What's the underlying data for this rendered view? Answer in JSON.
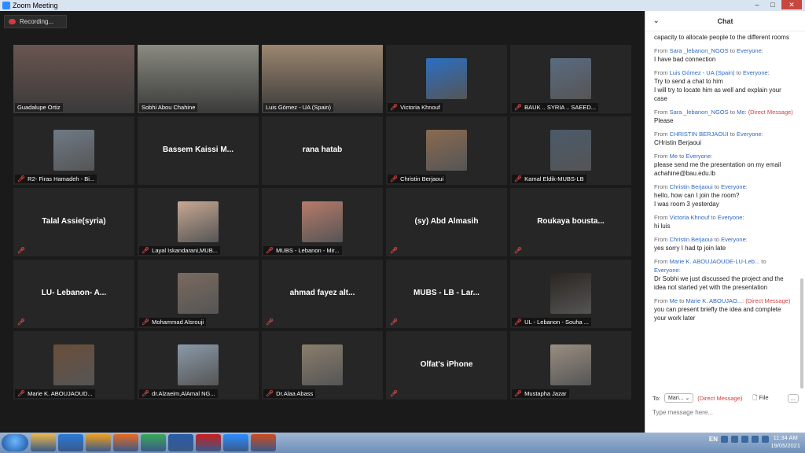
{
  "window": {
    "title": "Zoom Meeting"
  },
  "recording": {
    "label": "Recording..."
  },
  "tiles": [
    {
      "name": "Guadalupe Ortiz",
      "kind": "photo",
      "color": "#6a5550",
      "muted": false
    },
    {
      "name": "Sobhi Abou Chahine",
      "kind": "photo",
      "color": "#8a8a80",
      "muted": false
    },
    {
      "name": "Luis Gómez - UA (Spain)",
      "kind": "photo",
      "color": "#9c8670",
      "muted": false,
      "active": true
    },
    {
      "name": "Victoria Khnouf",
      "kind": "avatar",
      "color": "#2a6fc4",
      "muted": true
    },
    {
      "name": "BAUK .. SYRIA .. SAEED...",
      "kind": "avatar",
      "color": "#5a6b80",
      "muted": true
    },
    {
      "name": "R2- Firas Hamadeh - Bi...",
      "kind": "avatar",
      "color": "#6f7a86",
      "muted": true
    },
    {
      "name": "Bassem Kaissi M...",
      "kind": "text",
      "label": "",
      "muted": false
    },
    {
      "name": "rana hatab",
      "kind": "text",
      "label": "",
      "muted": false
    },
    {
      "name": "Christin Berjaoui",
      "kind": "avatar",
      "color": "#8a6a50",
      "muted": true
    },
    {
      "name": "Kamal Eldik-MUBS-LB",
      "kind": "avatar",
      "color": "#4a5a6a",
      "muted": true
    },
    {
      "name": "Talal Assie(syria)",
      "kind": "text",
      "label": "",
      "muted": true
    },
    {
      "name": "Layal Iskandarani,MUB...",
      "kind": "avatar",
      "color": "#c7a893",
      "muted": true
    },
    {
      "name": "MUBS - Lebanon - Mir...",
      "kind": "avatar",
      "color": "#b87a6a",
      "muted": true
    },
    {
      "name": "(sy) Abd Almasih",
      "kind": "text",
      "label": "",
      "muted": true
    },
    {
      "name": "Roukaya bousta...",
      "kind": "text",
      "label": "",
      "muted": true
    },
    {
      "name": "LU- Lebanon- A...",
      "kind": "text",
      "label": "",
      "muted": true
    },
    {
      "name": "Mohammad Alsrouji",
      "kind": "avatar",
      "color": "#7a6a5e",
      "muted": true
    },
    {
      "name": "ahmad fayez alt...",
      "kind": "text",
      "label": "",
      "muted": true
    },
    {
      "name": "MUBS - LB - Lar...",
      "kind": "text",
      "label": "",
      "muted": true
    },
    {
      "name": "UL - Lebanon - Souha ...",
      "kind": "avatar",
      "color": "#2a2520",
      "muted": true
    },
    {
      "name": "Marie K. ABOUJAOUD...",
      "kind": "avatar",
      "color": "#6a4e3a",
      "muted": true
    },
    {
      "name": "dr.Alzaeim,AlAmal NG...",
      "kind": "avatar",
      "color": "#8a9aa8",
      "muted": true
    },
    {
      "name": "Dr.Alaa Abass",
      "kind": "avatar",
      "color": "#8a7e6c",
      "muted": true
    },
    {
      "name": "Olfat's iPhone",
      "kind": "text",
      "label": "",
      "muted": true
    },
    {
      "name": "Mustapha Jazar",
      "kind": "avatar",
      "color": "#9a8e80",
      "muted": true
    }
  ],
  "chat": {
    "title": "Chat",
    "messages": [
      {
        "from": "",
        "to": "",
        "dm": "",
        "text": "capacity to allocate people to the different rooms"
      },
      {
        "from": "Sara _lebanon_NGOS",
        "to": "Everyone",
        "dm": "",
        "text": "I have bad connection"
      },
      {
        "from": "Luis Gómez - UA (Spain)",
        "to": "Everyone",
        "dm": "",
        "text": "Try to send a chat to him\nI will try to locate him as well and explain your case"
      },
      {
        "from": "Sara _lebanon_NGOS",
        "to": "Me",
        "dm": "(Direct Message)",
        "text": "Please"
      },
      {
        "from": "CHRISTIN BERJAOUI",
        "to": "Everyone",
        "dm": "",
        "text": "CHristin Berjaoui"
      },
      {
        "from": "Me",
        "to": "Everyone",
        "dm": "",
        "text": "please send me the presentation on my email\nachahine@bau.edu.lb"
      },
      {
        "from": "Christin Berjaoui",
        "to": "Everyone",
        "dm": "",
        "text": "hello, how can I join the room?\nI was room 3 yesterday"
      },
      {
        "from": "Victoria Khnouf",
        "to": "Everyone",
        "dm": "",
        "text": "hi luis"
      },
      {
        "from": "Christin Berjaoui",
        "to": "Everyone",
        "dm": "",
        "text": "yes sorry I had tp join late"
      },
      {
        "from": "Marie K. ABOUJAOUDE-LU-Leb...",
        "to": "Everyone",
        "dm": "",
        "text": "Dr Sobhi we just discussed the project and the idea not started yet with the presentation"
      },
      {
        "from": "Me",
        "to": "Marie K. ABOUJAO...",
        "dm": "(Direct Message)",
        "text": "you can present briefly the idea and complete your work later"
      }
    ],
    "to_label": "To:",
    "recipient": "Mari...",
    "dm_label": "(Direct Message)",
    "file_label": "File",
    "more_label": "...",
    "input_placeholder": "Type message here..."
  },
  "taskbar": {
    "lang": "EN",
    "time": "11:34 AM",
    "date": "19/05/2021",
    "apps": [
      {
        "name": "explorer",
        "color": "#e8b54a"
      },
      {
        "name": "internet-explorer",
        "color": "#2a7ad8"
      },
      {
        "name": "media-player",
        "color": "#f0a020"
      },
      {
        "name": "firefox",
        "color": "#e86a20"
      },
      {
        "name": "chrome",
        "color": "#3aa85a"
      },
      {
        "name": "word",
        "color": "#2a5aa8"
      },
      {
        "name": "acrobat",
        "color": "#c82020"
      },
      {
        "name": "zoom",
        "color": "#2d8cff"
      },
      {
        "name": "powerpoint",
        "color": "#d04a20"
      }
    ]
  }
}
